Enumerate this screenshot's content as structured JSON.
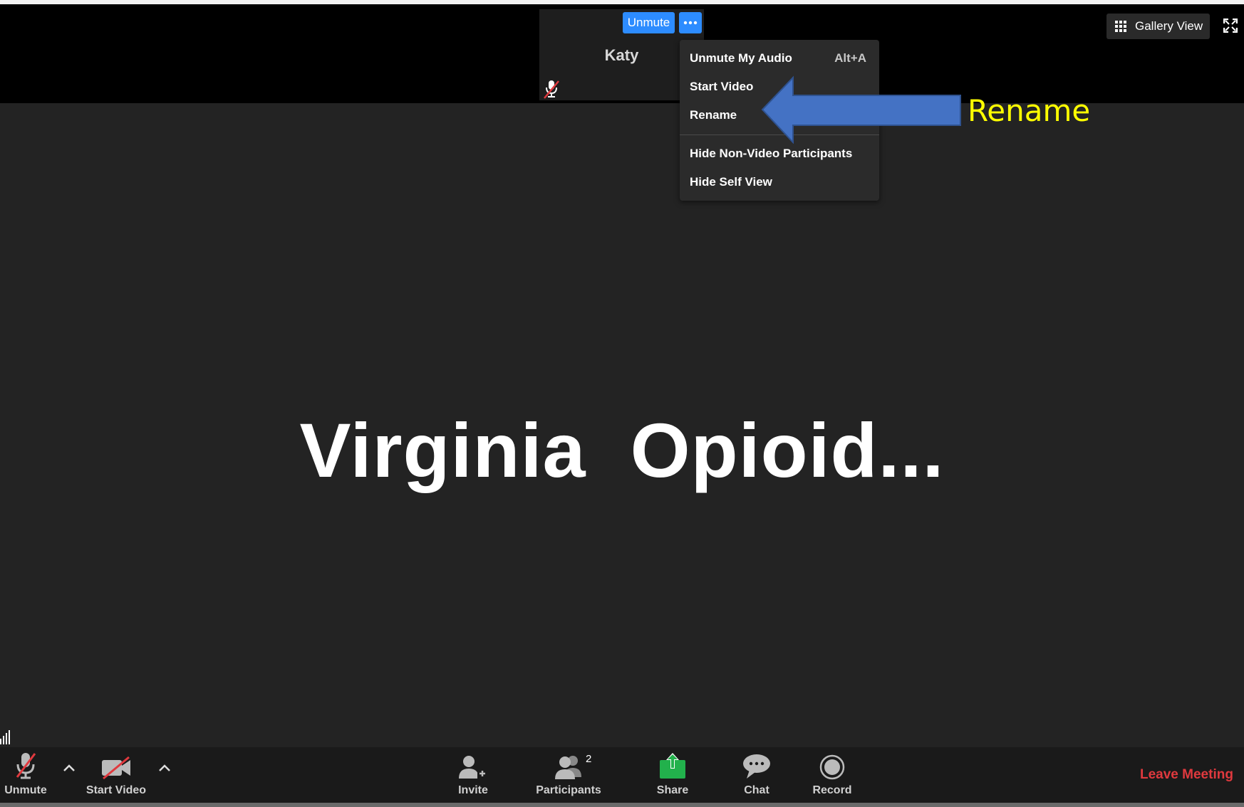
{
  "participant_tile": {
    "name": "Katy",
    "unmute_label": "Unmute"
  },
  "context_menu": {
    "items": [
      {
        "label": "Unmute My Audio",
        "shortcut": "Alt+A"
      },
      {
        "label": "Start Video"
      },
      {
        "label": "Rename"
      },
      {
        "label": "Hide Non-Video Participants"
      },
      {
        "label": "Hide Self View"
      }
    ]
  },
  "view": {
    "gallery_label": "Gallery View"
  },
  "meeting_title": "Virginia  Opioid...",
  "annotation": {
    "label": "Rename",
    "color": "#ffff00",
    "arrow_color": "#4472c4"
  },
  "toolbar": {
    "unmute_label": "Unmute",
    "start_video_label": "Start Video",
    "invite_label": "Invite",
    "participants_label": "Participants",
    "participants_count": "2",
    "share_label": "Share",
    "chat_label": "Chat",
    "record_label": "Record",
    "leave_label": "Leave Meeting"
  },
  "colors": {
    "accent": "#2d8cff",
    "share": "#22b14c",
    "leave": "#e0393e",
    "background": "#232323"
  }
}
